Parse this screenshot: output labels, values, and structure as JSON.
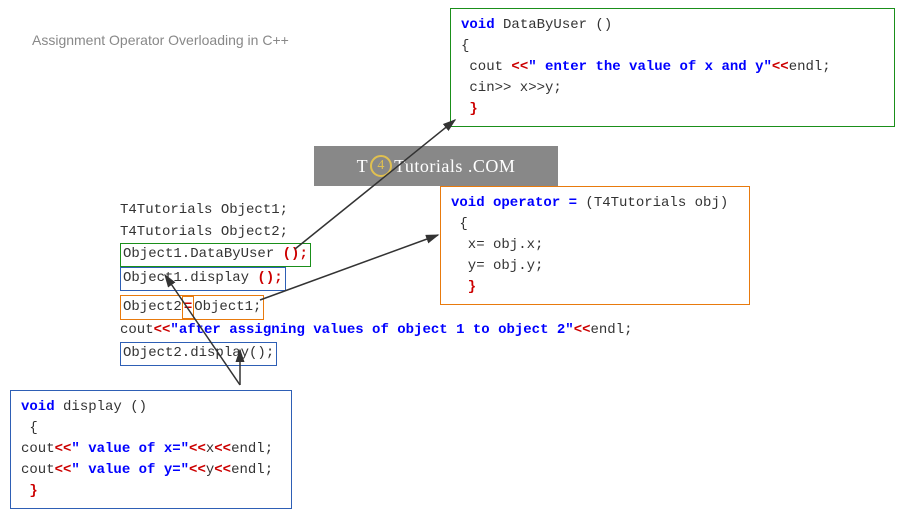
{
  "title": "Assignment Operator Overloading in C++",
  "logo": {
    "t": "T",
    "four": "4",
    "rest": "Tutorials .COM"
  },
  "dataByUser": {
    "sig": "void DataByUser ()",
    "open": "{",
    "l1a": " cout ",
    "l1op1": "<<",
    "l1str": "\" enter the value of x and y\"",
    "l1op2": "<<",
    "l1endl": "endl",
    "l1semi": ";",
    "l2": " cin>> x>>y;",
    "close": " }"
  },
  "operator": {
    "sig1": "void operator = ",
    "sig2": "(T4Tutorials obj)",
    "open": " {",
    "l1": "  x= obj.x;",
    "l2": "  y= obj.y;",
    "close": "  }"
  },
  "display": {
    "sig": " void display ()",
    "open": " {",
    "l1a": "cout",
    "l1op1": "<<",
    "l1str": "\" value of x=\"",
    "l1op2": "<<",
    "l1var": "x",
    "l1op3": "<<",
    "l1endl": "endl",
    "l1semi": ";",
    "l2a": "cout",
    "l2op1": "<<",
    "l2str": "\" value of y=\"",
    "l2op2": "<<",
    "l2var": "y",
    "l2op3": "<<",
    "l2endl": "endl",
    "l2semi": ";",
    "close": " }"
  },
  "main": {
    "l1": "T4Tutorials Object1;",
    "l2": "T4Tutorials Object2;",
    "l3a": "Object1.DataByUser ",
    "l3b": "();",
    "l4a": "Object1.display ",
    "l4b": "();",
    "l5a": "Object2",
    "l5eq": "=",
    "l5b": "Object1;",
    "l6a": "cout",
    "l6op1": "<<",
    "l6str": "\"after assigning values of object 1 to object 2\"",
    "l6op2": "<<",
    "l6endl": "endl",
    "l6semi": ";",
    "l7": "Object2.display();"
  }
}
